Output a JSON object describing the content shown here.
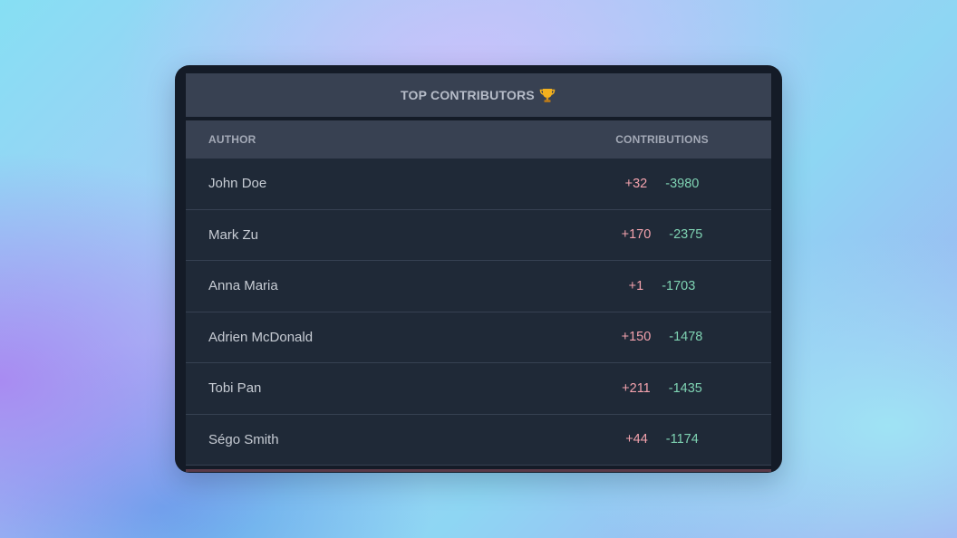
{
  "card": {
    "title": "TOP CONTRIBUTORS",
    "title_icon": "trophy-icon"
  },
  "table": {
    "headers": {
      "author": "AUTHOR",
      "contributions": "CONTRIBUTIONS"
    },
    "rows": [
      {
        "author": "John Doe",
        "additions": "+32",
        "deletions": "-3980"
      },
      {
        "author": "Mark Zu",
        "additions": "+170",
        "deletions": "-2375"
      },
      {
        "author": "Anna Maria",
        "additions": "+1",
        "deletions": "-1703"
      },
      {
        "author": "Adrien McDonald",
        "additions": "+150",
        "deletions": "-1478"
      },
      {
        "author": "Tobi Pan",
        "additions": "+211",
        "deletions": "-1435"
      },
      {
        "author": "Ségo Smith",
        "additions": "+44",
        "deletions": "-1174"
      }
    ]
  },
  "colors": {
    "additions": "#f3a2ad",
    "deletions": "#7fd3b3",
    "header_bg": "#384152",
    "row_bg": "#1f2937",
    "card_bg": "#141b27"
  }
}
